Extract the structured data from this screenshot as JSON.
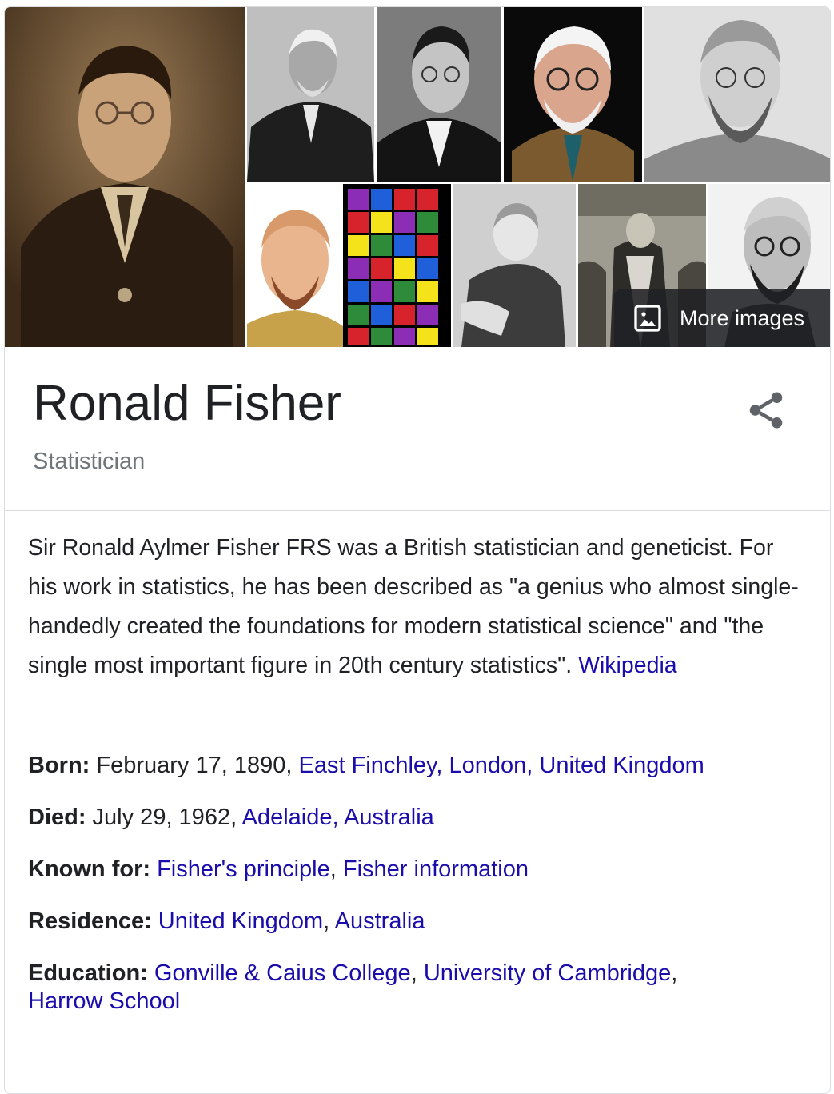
{
  "gallery": {
    "tiles": [
      {
        "name": "photo-young-portrait-sepia"
      },
      {
        "name": "photo-older-suit"
      },
      {
        "name": "photo-young-glasses-bw"
      },
      {
        "name": "photo-colorized-elderly"
      },
      {
        "name": "photo-bearded-elderly"
      },
      {
        "name": "photo-colored-grid-illustration"
      },
      {
        "name": "photo-child-portrait"
      },
      {
        "name": "photo-group-gowns"
      },
      {
        "name": "photo-bearded-glasses"
      }
    ],
    "more_images_label": "More images"
  },
  "header": {
    "title": "Ronald Fisher",
    "subtitle": "Statistician"
  },
  "description": {
    "text": "Sir Ronald Aylmer Fisher FRS was a British statistician and geneticist. For his work in statistics, he has been described as \"a genius who almost single-handedly created the foundations for modern statistical science\" and \"the single most important figure in 20th century statistics\". ",
    "source_link": "Wikipedia"
  },
  "facts": {
    "born": {
      "label": "Born:",
      "value": " February 17, 1890, ",
      "link": "East Finchley, London, United Kingdom"
    },
    "died": {
      "label": "Died:",
      "value": " July 29, 1962, ",
      "link": "Adelaide, Australia"
    },
    "known_for": {
      "label": "Known for:",
      "links": [
        "Fisher's principle",
        "Fisher information"
      ]
    },
    "residence": {
      "label": "Residence:",
      "links": [
        "United Kingdom",
        "Australia"
      ]
    },
    "education": {
      "label": "Education:",
      "links": [
        "Gonville & Caius College",
        "University of Cambridge",
        "Harrow School"
      ]
    }
  },
  "colors": {
    "link": "#1a0dab",
    "text": "#202124",
    "muted": "#70757a",
    "border": "#dadce0"
  }
}
